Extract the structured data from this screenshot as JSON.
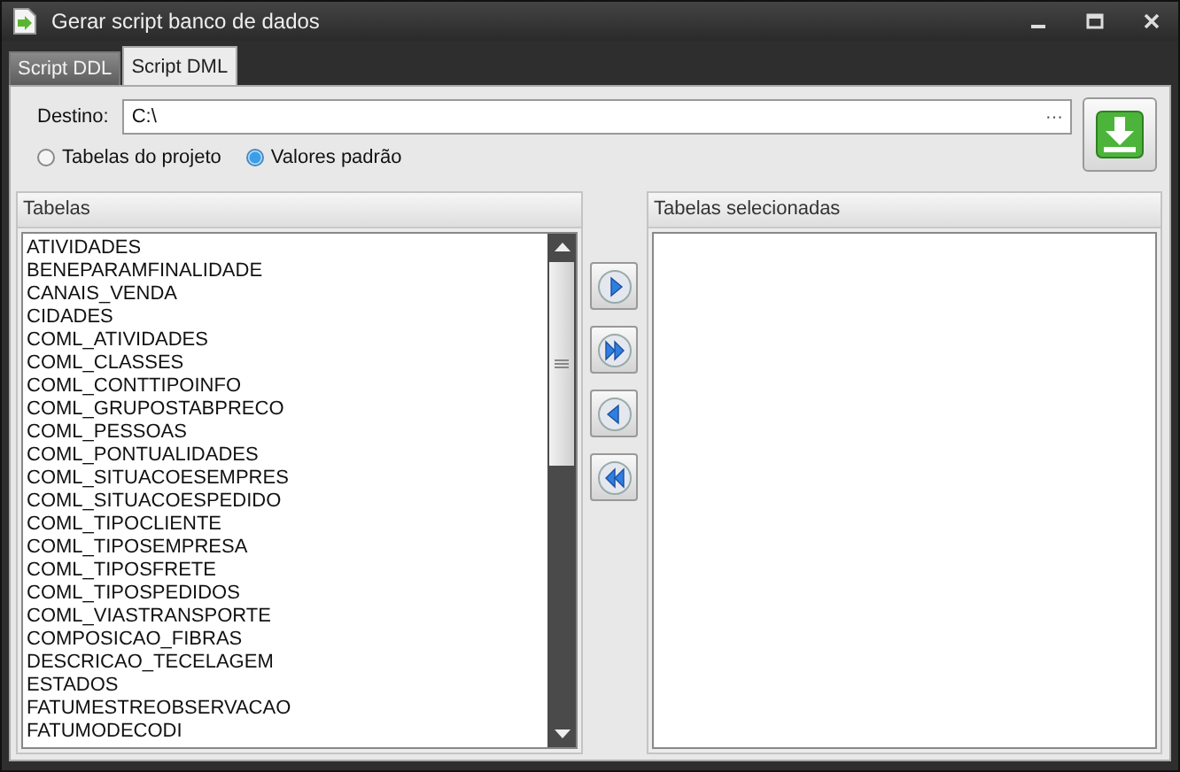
{
  "window": {
    "title": "Gerar script banco de dados"
  },
  "tabs": [
    {
      "label": "Script DDL",
      "selected": false
    },
    {
      "label": "Script DML",
      "selected": true
    }
  ],
  "destination": {
    "label": "Destino:",
    "value": "C:\\",
    "browse": "···"
  },
  "source_options": [
    {
      "label": "Tabelas do projeto",
      "selected": false
    },
    {
      "label": "Valores padrão",
      "selected": true
    }
  ],
  "tables": {
    "title": "Tabelas",
    "items": [
      "ATIVIDADES",
      "BENEPARAMFINALIDADE",
      "CANAIS_VENDA",
      "CIDADES",
      "COML_ATIVIDADES",
      "COML_CLASSES",
      "COML_CONTTIPOINFO",
      "COML_GRUPOSTABPRECO",
      "COML_PESSOAS",
      "COML_PONTUALIDADES",
      "COML_SITUACOESEMPRES",
      "COML_SITUACOESPEDIDO",
      "COML_TIPOCLIENTE",
      "COML_TIPOSEMPRESA",
      "COML_TIPOSFRETE",
      "COML_TIPOSPEDIDOS",
      "COML_VIASTRANSPORTE",
      "COMPOSICAO_FIBRAS",
      "DESCRICAO_TECELAGEM",
      "ESTADOS",
      "FATUMESTREOBSERVACAO",
      "FATUMODECODI"
    ]
  },
  "transfer_buttons": [
    {
      "kind": "add_one"
    },
    {
      "kind": "add_all"
    },
    {
      "kind": "remove_one"
    },
    {
      "kind": "remove_all"
    }
  ],
  "selected_tables": {
    "title": "Tabelas selecionadas"
  }
}
